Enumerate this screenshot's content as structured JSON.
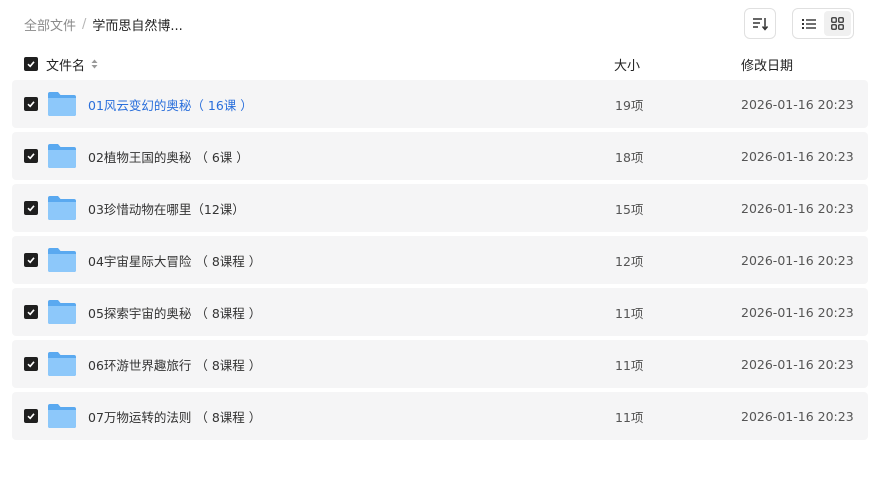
{
  "breadcrumb": {
    "root": "全部文件",
    "separator": "/",
    "current": "学而思自然博..."
  },
  "toolbar": {
    "sort_icon": "sort-list-icon",
    "view_list_icon": "list-view-icon",
    "view_grid_icon": "grid-view-icon"
  },
  "header": {
    "name": "文件名",
    "size": "大小",
    "date": "修改日期"
  },
  "colors": {
    "folder": "#7cbef6",
    "highlight_text": "#2a6fdb",
    "row_bg": "#f5f5f6",
    "checkbox": "#1f1f1f"
  },
  "files": [
    {
      "name": "01风云变幻的奥秘（ 16课 ）",
      "size": "19项",
      "date": "2026-01-16 20:23",
      "checked": true
    },
    {
      "name": "02植物王国的奥秘 （ 6课 ）",
      "size": "18项",
      "date": "2026-01-16 20:23",
      "checked": true
    },
    {
      "name": "03珍惜动物在哪里（12课）",
      "size": "15项",
      "date": "2026-01-16 20:23",
      "checked": true
    },
    {
      "name": "04宇宙星际大冒险 （ 8课程 ）",
      "size": "12项",
      "date": "2026-01-16 20:23",
      "checked": true
    },
    {
      "name": "05探索宇宙的奥秘 （ 8课程 ）",
      "size": "11项",
      "date": "2026-01-16 20:23",
      "checked": true
    },
    {
      "name": "06环游世界趣旅行 （ 8课程 ）",
      "size": "11项",
      "date": "2026-01-16 20:23",
      "checked": true
    },
    {
      "name": "07万物运转的法则 （ 8课程 ）",
      "size": "11项",
      "date": "2026-01-16 20:23",
      "checked": true
    }
  ]
}
